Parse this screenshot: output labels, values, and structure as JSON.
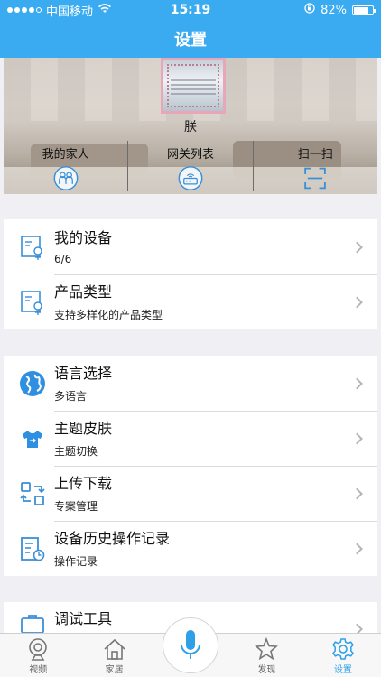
{
  "status_bar": {
    "carrier": "中国移动",
    "time": "15:19",
    "battery_text": "82%",
    "battery_level": 0.82,
    "icons": [
      "signal-dots",
      "wifi-icon",
      "orientation-lock-icon",
      "battery-icon"
    ]
  },
  "header": {
    "title": "设置"
  },
  "profile": {
    "username": "朕",
    "quick_links": [
      {
        "label": "我的家人",
        "icon": "family-icon"
      },
      {
        "label": "网关列表",
        "icon": "gateway-icon"
      },
      {
        "label": "扫一扫",
        "icon": "scan-icon"
      }
    ]
  },
  "sections": [
    {
      "rows": [
        {
          "title": "我的设备",
          "subtitle": "6/6",
          "icon": "device-icon"
        },
        {
          "title": "产品类型",
          "subtitle": "支持多样化的产品类型",
          "icon": "product-type-icon"
        }
      ]
    },
    {
      "rows": [
        {
          "title": "语言选择",
          "subtitle": "多语言",
          "icon": "globe-icon"
        },
        {
          "title": "主题皮肤",
          "subtitle": "主题切换",
          "icon": "tshirt-icon"
        },
        {
          "title": "上传下载",
          "subtitle": "专案管理",
          "icon": "sync-icon"
        },
        {
          "title": "设备历史操作记录",
          "subtitle": "操作记录",
          "icon": "history-log-icon"
        }
      ]
    },
    {
      "rows": [
        {
          "title": "调试工具",
          "subtitle": "",
          "icon": "toolbox-icon"
        }
      ]
    }
  ],
  "tabbar": {
    "tabs": [
      {
        "label": "视频",
        "icon": "camera-icon",
        "active": false
      },
      {
        "label": "家居",
        "icon": "home-icon",
        "active": false
      },
      {
        "label": "",
        "icon": "microphone-icon",
        "active": false
      },
      {
        "label": "发现",
        "icon": "star-icon",
        "active": false
      },
      {
        "label": "设置",
        "icon": "gear-icon",
        "active": true
      }
    ]
  },
  "colors": {
    "accent": "#3aabf0",
    "active_tab": "#2f9fe8",
    "background": "#efeff4"
  }
}
